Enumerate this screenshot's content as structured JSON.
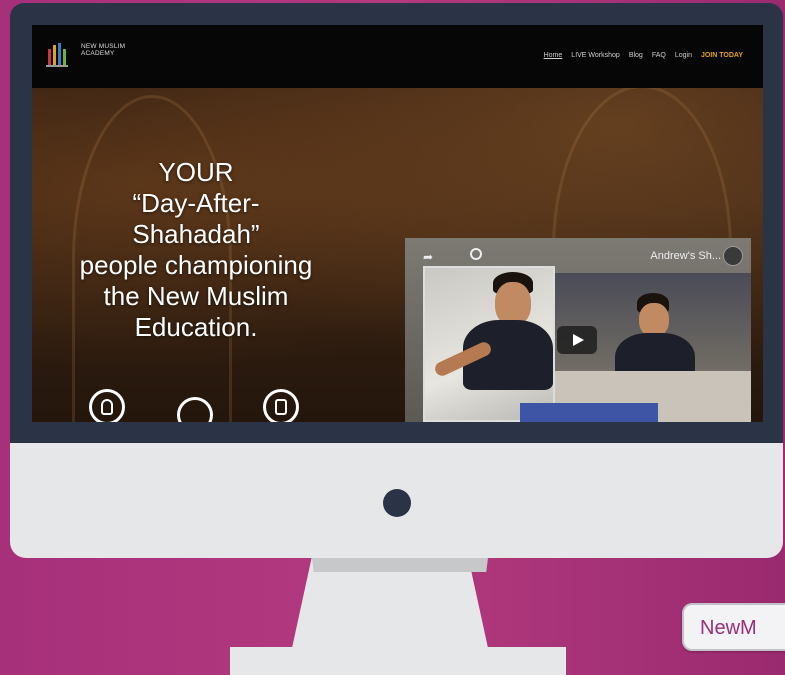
{
  "site": {
    "logo_text": "NEW MUSLIM ACADEMY",
    "nav": {
      "home": "Home",
      "live_workshop": "LIVE Workshop",
      "blog": "Blog",
      "faq": "FAQ",
      "login": "Login",
      "join": "JOIN TODAY"
    },
    "hero_lines": [
      "YOUR",
      "“Day-After-",
      "Shahadah”",
      "people championing",
      "the New Muslim",
      "Education."
    ]
  },
  "video": {
    "title": "Andrew's Sh..."
  },
  "badge_text": "NewM",
  "colors": {
    "background": "#a6307a",
    "bezel": "#2b3446",
    "chin": "#e6e7e8",
    "accent_join": "#e3a21a",
    "badge_text": "#9a2f7c"
  },
  "icons": [
    "logo-icon",
    "share-icon",
    "search-icon",
    "play-icon",
    "user-icon",
    "gear-icon",
    "edit-icon"
  ]
}
